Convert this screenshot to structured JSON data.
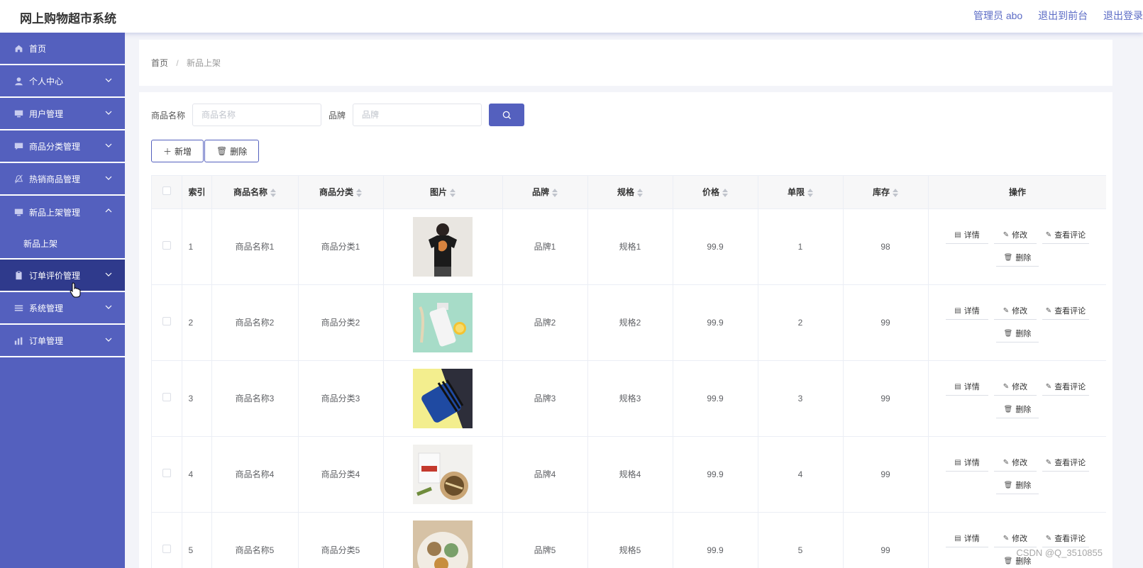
{
  "header": {
    "title": "网上购物超市系统",
    "admin_label": "管理员 abo",
    "back_label": "退出到前台",
    "logout_label": "退出登录"
  },
  "sidebar": {
    "items": [
      {
        "label": "首页",
        "icon": "home-icon"
      },
      {
        "label": "个人中心",
        "icon": "user-icon"
      },
      {
        "label": "用户管理",
        "icon": "monitor-icon"
      },
      {
        "label": "商品分类管理",
        "icon": "chat-icon"
      },
      {
        "label": "热销商品管理",
        "icon": "bell-off-icon"
      },
      {
        "label": "新品上架管理",
        "icon": "monitor-icon"
      },
      {
        "label": "订单评价管理",
        "icon": "clipboard-icon"
      },
      {
        "label": "系统管理",
        "icon": "list-icon"
      },
      {
        "label": "订单管理",
        "icon": "chart-icon"
      }
    ],
    "subitem_label": "新品上架"
  },
  "breadcrumb": {
    "home": "首页",
    "sep": "/",
    "current": "新品上架"
  },
  "search": {
    "name_label": "商品名称",
    "name_placeholder": "商品名称",
    "brand_label": "品牌",
    "brand_placeholder": "品牌"
  },
  "actions": {
    "add_label": "新增",
    "delete_label": "删除"
  },
  "table": {
    "headers": [
      "索引",
      "商品名称",
      "商品分类",
      "图片",
      "品牌",
      "规格",
      "价格",
      "单限",
      "库存",
      "操作"
    ],
    "op_labels": {
      "detail": "详情",
      "edit": "修改",
      "review": "查看评论",
      "delete": "删除"
    },
    "rows": [
      {
        "index": "1",
        "name": "商品名称1",
        "category": "商品分类1",
        "brand": "品牌1",
        "spec": "规格1",
        "price": "99.9",
        "limit": "1",
        "stock": "98"
      },
      {
        "index": "2",
        "name": "商品名称2",
        "category": "商品分类2",
        "brand": "品牌2",
        "spec": "规格2",
        "price": "99.9",
        "limit": "2",
        "stock": "99"
      },
      {
        "index": "3",
        "name": "商品名称3",
        "category": "商品分类3",
        "brand": "品牌3",
        "spec": "规格3",
        "price": "99.9",
        "limit": "3",
        "stock": "99"
      },
      {
        "index": "4",
        "name": "商品名称4",
        "category": "商品分类4",
        "brand": "品牌4",
        "spec": "规格4",
        "price": "99.9",
        "limit": "4",
        "stock": "99"
      },
      {
        "index": "5",
        "name": "商品名称5",
        "category": "商品分类5",
        "brand": "品牌5",
        "spec": "规格5",
        "price": "99.9",
        "limit": "5",
        "stock": "99"
      }
    ]
  },
  "watermark": "CSDN @Q_3510855",
  "colors": {
    "accent": "#5460be",
    "accent_dark": "#2f3a8c"
  }
}
